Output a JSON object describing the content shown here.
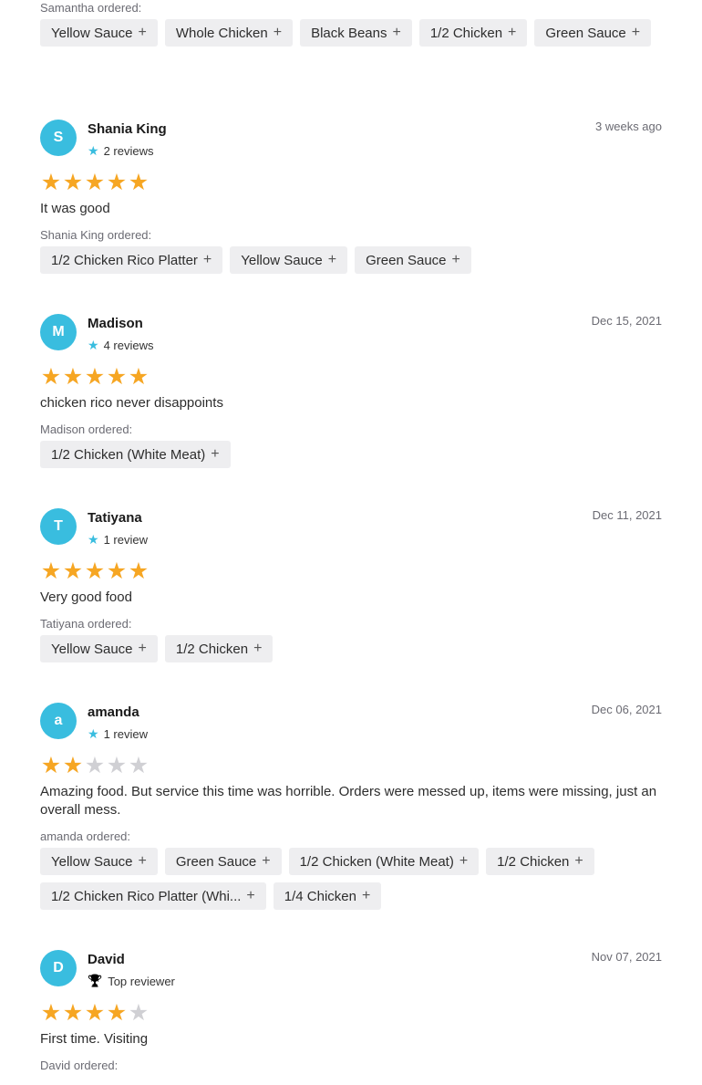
{
  "top_order": {
    "label": "Samantha ordered:",
    "items": [
      "Yellow Sauce",
      "Whole Chicken",
      "Black Beans",
      "1/2 Chicken",
      "Green Sauce"
    ]
  },
  "plus_glyph": "+",
  "star_glyph": "★",
  "colors": {
    "avatar": "#39bddf",
    "star_on": "#f6a623",
    "star_off": "#d0d0d4",
    "chip_bg": "#eeeef0"
  },
  "reviews": [
    {
      "initial": "S",
      "name": "Shania King",
      "meta_icon": "star-icon",
      "meta": "2 reviews",
      "date": "3 weeks ago",
      "rating": 5,
      "text": "It was good",
      "ordered_label": "Shania King ordered:",
      "items": [
        "1/2 Chicken Rico Platter",
        "Yellow Sauce",
        "Green Sauce"
      ]
    },
    {
      "initial": "M",
      "name": "Madison",
      "meta_icon": "star-icon",
      "meta": "4 reviews",
      "date": "Dec 15, 2021",
      "rating": 5,
      "text": "chicken rico never disappoints",
      "ordered_label": "Madison ordered:",
      "items": [
        "1/2 Chicken (White Meat)"
      ]
    },
    {
      "initial": "T",
      "name": "Tatiyana",
      "meta_icon": "star-icon",
      "meta": "1 review",
      "date": "Dec 11, 2021",
      "rating": 5,
      "text": "Very good food",
      "ordered_label": "Tatiyana ordered:",
      "items": [
        "Yellow Sauce",
        "1/2 Chicken"
      ]
    },
    {
      "initial": "a",
      "name": "amanda",
      "meta_icon": "star-icon",
      "meta": "1 review",
      "date": "Dec 06, 2021",
      "rating": 2,
      "text": "Amazing food. But service this time was horrible. Orders were messed up, items were missing, just an overall mess.",
      "ordered_label": "amanda ordered:",
      "items": [
        "Yellow Sauce",
        "Green Sauce",
        "1/2 Chicken (White Meat)",
        "1/2 Chicken",
        "1/2 Chicken Rico Platter (Whi...",
        "1/4 Chicken"
      ]
    },
    {
      "initial": "D",
      "name": "David",
      "meta_icon": "trophy-icon",
      "meta": "Top reviewer",
      "date": "Nov 07, 2021",
      "rating": 4,
      "text": "First time. Visiting",
      "ordered_label": "David ordered:",
      "items": []
    }
  ]
}
